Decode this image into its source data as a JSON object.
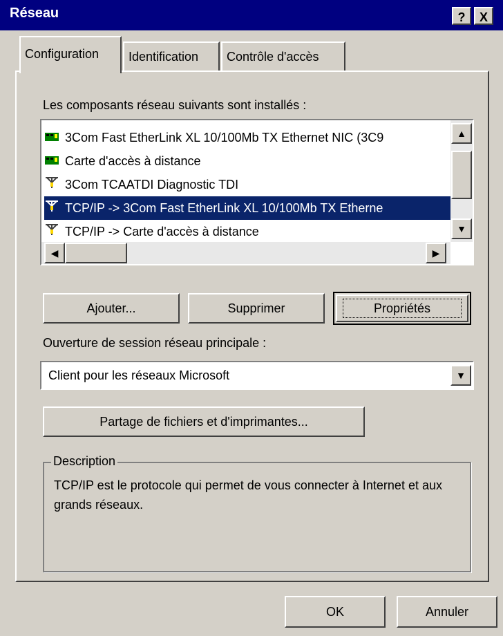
{
  "window": {
    "title": "Réseau",
    "help_btn": "?",
    "close_btn": "X"
  },
  "tabs": [
    {
      "label": "Configuration",
      "active": true
    },
    {
      "label": "Identification",
      "active": false
    },
    {
      "label": "Contrôle d'accès",
      "active": false
    }
  ],
  "components": {
    "label": "Les composants réseau suivants sont installés :",
    "items": [
      {
        "label": "3Com Fast EtherLink XL 10/100Mb TX Ethernet NIC (3C9",
        "icon": "network-card-icon"
      },
      {
        "label": "Carte d'accès à distance",
        "icon": "network-card-icon"
      },
      {
        "label": "3Com TCAATDI Diagnostic TDI",
        "icon": "protocol-icon"
      },
      {
        "label": "TCP/IP -> 3Com Fast EtherLink XL 10/100Mb TX Etherne",
        "icon": "protocol-icon",
        "selected": true
      },
      {
        "label": "TCP/IP -> Carte d'accès à distance",
        "icon": "protocol-icon"
      }
    ]
  },
  "buttons": {
    "add": "Ajouter...",
    "remove": "Supprimer",
    "properties": "Propriétés"
  },
  "logon": {
    "label": "Ouverture de session réseau principale :",
    "value": "Client pour les réseaux Microsoft"
  },
  "sharing_button": "Partage de fichiers et d'imprimantes...",
  "description": {
    "label": "Description",
    "text": "TCP/IP est le protocole qui permet de vous connecter à Internet et aux grands réseaux."
  },
  "footer": {
    "ok": "OK",
    "cancel": "Annuler"
  },
  "colors": {
    "titlebar": "#000080",
    "selection": "#0a246a",
    "face": "#d4d0c8"
  }
}
